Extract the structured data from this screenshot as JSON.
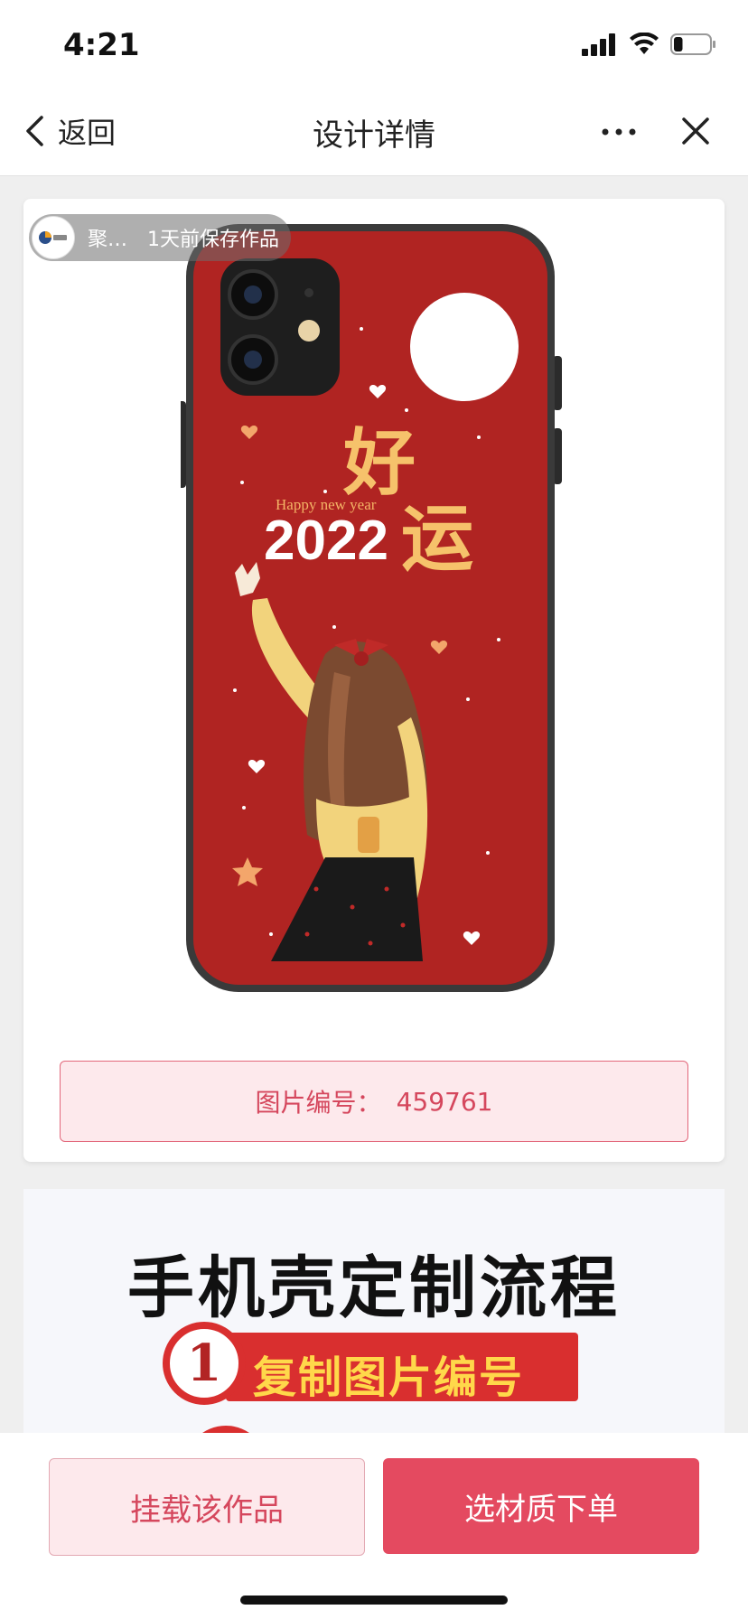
{
  "status_bar": {
    "time": "4:21",
    "battery_level": 0.25
  },
  "nav": {
    "back_label": "返回",
    "title": "设计详情"
  },
  "design": {
    "author_name": "聚…",
    "saved_text": "1天前保存作品",
    "artwork": {
      "greeting": "Happy new year",
      "year": "2022",
      "slogan_top": "好",
      "slogan_bottom": "运"
    },
    "code_label": "图片编号：",
    "code_value": "459761"
  },
  "process": {
    "title": "手机壳定制流程",
    "steps": [
      {
        "number": "1",
        "label": "复制图片编号"
      }
    ]
  },
  "actions": {
    "mount_label": "挂载该作品",
    "order_label": "选材质下单"
  },
  "colors": {
    "accent": "#e44a60",
    "case_red": "#b02422",
    "soft_pink": "#fde9ec"
  }
}
